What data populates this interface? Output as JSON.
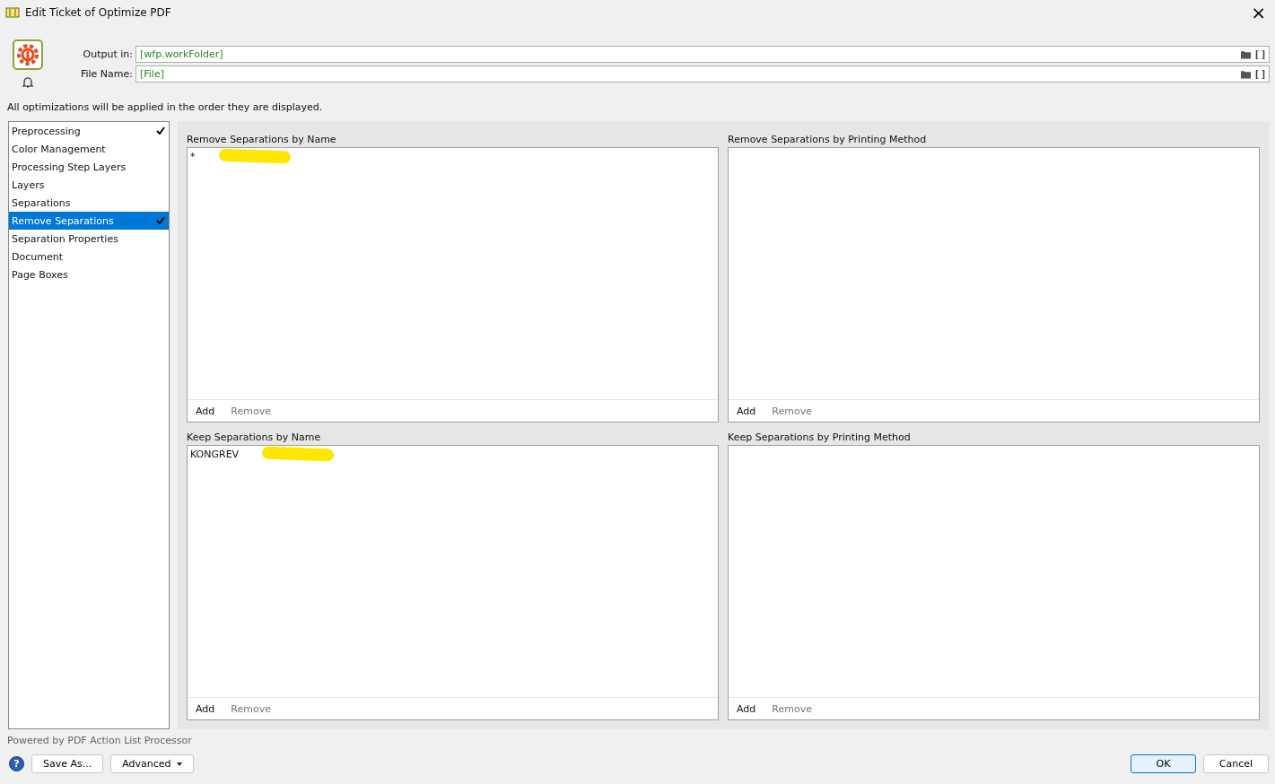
{
  "window": {
    "title": "Edit Ticket of Optimize PDF",
    "close": "×"
  },
  "fields": [
    {
      "label": "Output in:",
      "value": "[wfp.workFolder]"
    },
    {
      "label": "File Name:",
      "value": "[File]"
    }
  ],
  "info": "All optimizations will be applied in the order they are displayed.",
  "sidebar": {
    "items": [
      {
        "label": "Preprocessing",
        "checked": true,
        "selected": false
      },
      {
        "label": "Color Management",
        "checked": false,
        "selected": false
      },
      {
        "label": "Processing Step Layers",
        "checked": false,
        "selected": false
      },
      {
        "label": "Layers",
        "checked": false,
        "selected": false
      },
      {
        "label": "Separations",
        "checked": false,
        "selected": false
      },
      {
        "label": "Remove Separations",
        "checked": true,
        "selected": true
      },
      {
        "label": "Separation Properties",
        "checked": false,
        "selected": false
      },
      {
        "label": "Document",
        "checked": false,
        "selected": false
      },
      {
        "label": "Page Boxes",
        "checked": false,
        "selected": false
      }
    ]
  },
  "panels": [
    {
      "title": "Remove Separations by Name",
      "entries": [
        "*"
      ],
      "redacted": true,
      "buttons": [
        {
          "label": "Add",
          "disabled": false
        },
        {
          "label": "Remove",
          "disabled": true
        }
      ]
    },
    {
      "title": "Remove Separations by Printing Method",
      "redacted": false,
      "buttons": [
        {
          "label": "Add",
          "disabled": false
        },
        {
          "label": "Remove",
          "disabled": true
        }
      ]
    },
    {
      "title": "Keep Separations by Name",
      "entries": [
        "KONGREV"
      ],
      "redacted": true,
      "buttons": [
        {
          "label": "Add",
          "disabled": false
        },
        {
          "label": "Remove",
          "disabled": true
        }
      ]
    },
    {
      "title": "Keep Separations by Printing Method",
      "redacted": false,
      "buttons": [
        {
          "label": "Add",
          "disabled": false
        },
        {
          "label": "Remove",
          "disabled": true
        }
      ]
    }
  ],
  "footer": {
    "powered": "Powered by PDF Action List Processor",
    "help": "?",
    "left_buttons": [
      {
        "label": "Save As...",
        "dropdown": false
      },
      {
        "label": "Advanced",
        "dropdown": true
      }
    ],
    "right_buttons": [
      {
        "label": "OK",
        "default": true
      },
      {
        "label": "Cancel",
        "default": false
      }
    ]
  }
}
